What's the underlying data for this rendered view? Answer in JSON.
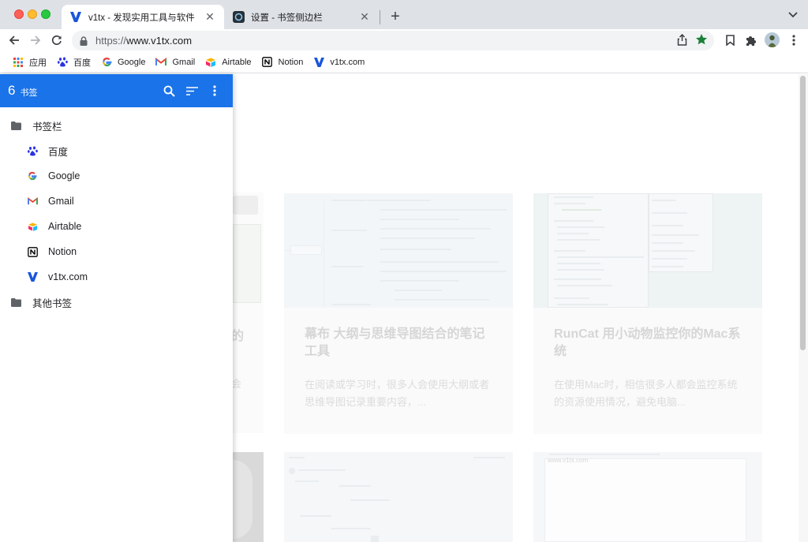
{
  "tabs": [
    {
      "title": "v1tx - 发现实用工具与软件",
      "favicon": "v1tx-logo-icon",
      "active": true
    },
    {
      "title": "设置 - 书签侧边栏",
      "favicon": "extension-icon",
      "active": false
    }
  ],
  "address_bar": {
    "url_prefix": "https://",
    "url_host": "www.v1tx.com"
  },
  "bookmarks_bar": [
    {
      "label": "应用",
      "icon": "apps-grid-icon"
    },
    {
      "label": "百度",
      "icon": "baidu-icon"
    },
    {
      "label": "Google",
      "icon": "google-icon"
    },
    {
      "label": "Gmail",
      "icon": "gmail-icon"
    },
    {
      "label": "Airtable",
      "icon": "airtable-icon"
    },
    {
      "label": "Notion",
      "icon": "notion-icon"
    },
    {
      "label": "v1tx.com",
      "icon": "v1tx-logo-icon"
    }
  ],
  "side_panel": {
    "count": "6",
    "count_label": "书签",
    "tree": {
      "folder1": {
        "label": "书签栏",
        "icon": "folder-icon"
      },
      "items": [
        {
          "label": "百度",
          "icon": "baidu-icon"
        },
        {
          "label": "Google",
          "icon": "google-icon"
        },
        {
          "label": "Gmail",
          "icon": "gmail-icon"
        },
        {
          "label": "Airtable",
          "icon": "airtable-icon"
        },
        {
          "label": "Notion",
          "icon": "notion-icon"
        },
        {
          "label": "v1tx.com",
          "icon": "v1tx-logo-icon"
        }
      ],
      "folder2": {
        "label": "其他书签",
        "icon": "folder-icon"
      }
    }
  },
  "page": {
    "cards": [
      {
        "title": "幕布 大纲与思维导图结合的笔记工具",
        "desc": "在阅读或学习时，很多人会使用大纲或者思维导图记录重要内容，..."
      },
      {
        "title": "RunCat 用小动物监控你的Mac系统",
        "desc": "在使用Mac时，相信很多人都会监控系统的资源使用情况，避免电脑..."
      }
    ],
    "partial_card_title_fragment": "的",
    "partial_card_desc_fragment": "会",
    "thumb_url_text": "www.v1tx.com",
    "colors": {
      "accent": "#1a73e8",
      "star": "#188038"
    }
  }
}
